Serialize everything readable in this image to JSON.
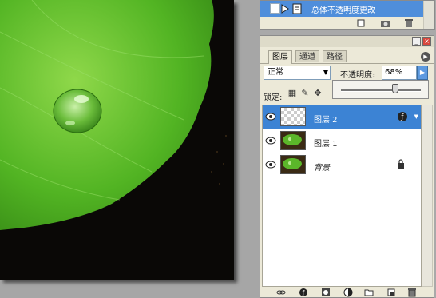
{
  "history": {
    "current_step": "总体不透明度更改"
  },
  "layers_panel": {
    "tabs": [
      {
        "label": "图层",
        "active": true
      },
      {
        "label": "通道",
        "active": false
      },
      {
        "label": "路径",
        "active": false
      }
    ],
    "blend_mode": "正常",
    "opacity_label": "不透明度:",
    "opacity_value": "68%",
    "opacity_level": 0.68,
    "lock_label": "锁定:",
    "layers": [
      {
        "name": "图层 2",
        "visible": true,
        "selected": true,
        "thumb": "transparent",
        "badge": "style-icon"
      },
      {
        "name": "图层 1",
        "visible": true,
        "selected": false,
        "thumb": "leaf"
      },
      {
        "name": "背景",
        "visible": true,
        "selected": false,
        "thumb": "leaf",
        "badge": "lock-icon"
      }
    ],
    "bottom_icons": [
      "link-icon",
      "style-icon",
      "mask-icon",
      "adjustment-icon",
      "folder-icon",
      "new-layer-icon",
      "trash-icon"
    ]
  },
  "colors": {
    "selection_blue": "#3c83d4",
    "panel_bg": "#ece9d8",
    "leaf_green": "#57b52a"
  }
}
